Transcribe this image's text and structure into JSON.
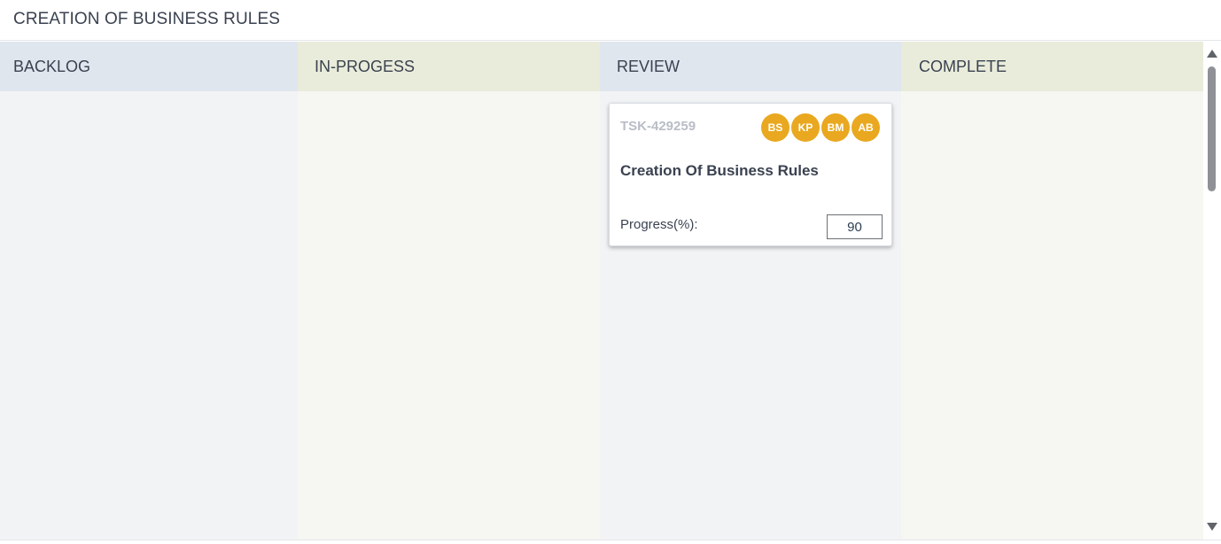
{
  "page": {
    "title": "CREATION OF BUSINESS RULES"
  },
  "columns": [
    {
      "title": "BACKLOG"
    },
    {
      "title": "IN-PROGESS"
    },
    {
      "title": "REVIEW"
    },
    {
      "title": "COMPLETE"
    }
  ],
  "cards": [
    {
      "column": "REVIEW",
      "id": "TSK-429259",
      "name": "Creation Of Business Rules",
      "assignees": [
        "BS",
        "KP",
        "BM",
        "AB"
      ],
      "progress_label": "Progress(%):",
      "progress_value": "90"
    }
  ],
  "colors": {
    "avatar": "#e9a81f",
    "header_blue": "#e0e6ee",
    "header_green": "#e9ecda"
  }
}
